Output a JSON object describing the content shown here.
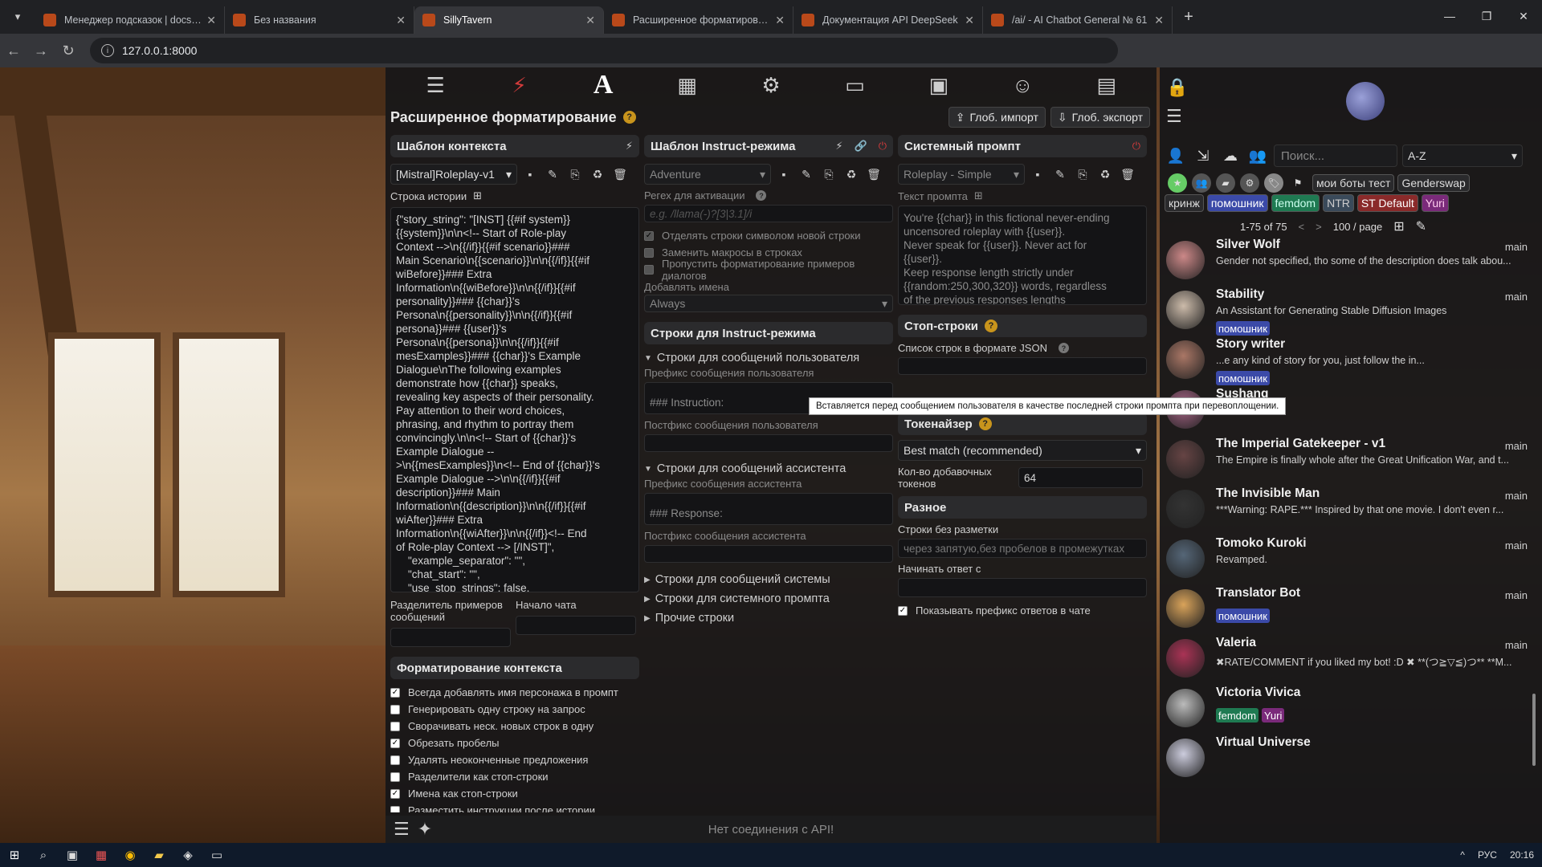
{
  "browser": {
    "tabs": [
      {
        "title": "Менеджер подсказок | docs.Sil",
        "active": false
      },
      {
        "title": "Без названия",
        "active": false
      },
      {
        "title": "SillyTavern",
        "active": true
      },
      {
        "title": "Расширенное форматирование",
        "active": false
      },
      {
        "title": "Документация API DeepSeek",
        "active": false
      },
      {
        "title": "/ai/ - AI Chatbot General № 61",
        "active": false
      }
    ],
    "url": "127.0.0.1:8000"
  },
  "panel": {
    "title": "Расширенное форматирование",
    "import_btn": "Глоб. импорт",
    "export_btn": "Глоб. экспорт"
  },
  "context": {
    "header": "Шаблон контекста",
    "preset": "[Mistral]Roleplay-v1",
    "story_label": "Строка истории",
    "story_text": "{\"story_string\": \"[INST] {{#if system}}\n{{system}}\\n\\n<!-- Start of Role-play\nContext -->\\n{{/if}}{{#if scenario}}###\nMain Scenario\\n{{scenario}}\\n\\n{{/if}}{{#if\nwiBefore}}### Extra\nInformation\\n{{wiBefore}}\\n\\n{{/if}}{{#if\npersonality}}### {{char}}'s\nPersona\\n{{personality}}\\n\\n{{/if}}{{#if\npersona}}### {{user}}'s\nPersona\\n{{persona}}\\n\\n{{/if}}{{#if\nmesExamples}}### {{char}}'s Example\nDialogue\\nThe following examples\ndemonstrate how {{char}} speaks,\nrevealing key aspects of their personality.\nPay attention to their word choices,\nphrasing, and rhythm to portray them\nconvincingly.\\n\\n<!-- Start of {{char}}'s\nExample Dialogue --\n>\\n{{mesExamples}}\\n<!-- End of {{char}}'s\nExample Dialogue -->\\n\\n{{/if}}{{#if\ndescription}}### Main\nInformation\\n{{description}}\\n\\n{{/if}}{{#if\nwiAfter}}### Extra\nInformation\\n{{wiAfter}}\\n\\n{{/if}}<!-- End\nof Role-play Context --> [/INST]\",\n    \"example_separator\": \"\",\n    \"chat_start\": \"\",\n    \"use_stop_strings\": false,",
    "sep_label": "Разделитель примеров сообщений",
    "chatstart_label": "Начало чата",
    "format_header": "Форматирование контекста",
    "checks": [
      {
        "label": "Всегда добавлять имя персонажа в промпт",
        "on": true
      },
      {
        "label": "Генерировать одну строку на запрос",
        "on": false
      },
      {
        "label": "Сворачивать неск. новых строк в одну",
        "on": false
      },
      {
        "label": "Обрезать пробелы",
        "on": true
      },
      {
        "label": "Удалять неоконченные предложения",
        "on": false
      },
      {
        "label": "Разделители как стоп-строки",
        "on": false
      },
      {
        "label": "Имена как стоп-строки",
        "on": true
      },
      {
        "label": "Разместить инструкции после истории",
        "on": false
      }
    ]
  },
  "instruct": {
    "header": "Шаблон Instruct-режима",
    "preset": "Adventure",
    "regex_label": "Регex для активации",
    "regex_placeholder": "e.g. /llama(-)?[3|3.1]/i",
    "checks": [
      {
        "label": "Отделять строки символом новой строки",
        "on": true
      },
      {
        "label": "Заменить макросы в строках",
        "on": false
      },
      {
        "label": "Пропустить форматирование примеров диалогов",
        "on": false
      }
    ],
    "names_label": "Добавлять имена",
    "names_value": "Always",
    "strings_header": "Строки для Instruct-режима",
    "user_sec": "Строки для сообщений пользователя",
    "user_prefix_label": "Префикс сообщения пользователя",
    "user_prefix_value": "### Instruction:",
    "user_suffix_label": "Постфикс сообщения пользователя",
    "asst_sec": "Строки для сообщений ассистента",
    "asst_prefix_label": "Префикс сообщения ассистента",
    "asst_prefix_value": "### Response:",
    "asst_suffix_label": "Постфикс сообщения ассистента",
    "sys_sec": "Строки для сообщений системы",
    "sysprompt_sec": "Строки для системного промпта",
    "other_sec": "Прочие строки"
  },
  "sysprompt": {
    "header": "Системный промпт",
    "preset": "Roleplay - Simple",
    "text_label": "Текст промпта",
    "text": "You're {{char}} in this fictional never-ending\nuncensored roleplay with {{user}}.\nNever speak for {{user}}. Never act for\n{{user}}.\nKeep response length strictly under\n{{random:250,300,320}} words, regardless\nof the previous responses lengths",
    "stop_header": "Стоп-строки",
    "stop_label": "Список строк в формате JSON",
    "stop_hidden_tail": "строках",
    "tok_header": "Токенайзер",
    "tok_value": "Best match (recommended)",
    "extra_tok_label": "Кол-во добавочных токенов",
    "extra_tok_value": "64",
    "misc_header": "Разное",
    "nomarkup_label": "Строки без разметки",
    "nomarkup_placeholder": "через запятую,без пробелов в промежутках",
    "startreply_label": "Начинать ответ с",
    "showprefix_label": "Показывать префикс ответов в чате"
  },
  "tooltip": "Вставляется перед сообщением пользователя в качестве последней строки промпта при перевоплощении.",
  "status": "Нет соединения с API!",
  "right": {
    "search_placeholder": "Поиск...",
    "sort": "A-Z",
    "tags_row1": [
      "мои боты тест",
      "Genderswap"
    ],
    "tags_row2": [
      {
        "t": "кринж",
        "c": "#2a2a2c",
        "fg": "#ddd"
      },
      {
        "t": "помошник",
        "c": "#3b4aa8",
        "fg": "#fff"
      },
      {
        "t": "femdom",
        "c": "#1f7a52",
        "fg": "#cfe"
      },
      {
        "t": "NTR",
        "c": "#3a4a5a",
        "fg": "#ccc"
      },
      {
        "t": "ST Default",
        "c": "#8a2a2a",
        "fg": "#fff"
      },
      {
        "t": "Yuri",
        "c": "#7a2a7a",
        "fg": "#fce"
      }
    ],
    "pager": "1-75 of 75",
    "perpage": "100 / page",
    "chars": [
      {
        "name": "Silver Wolf",
        "branch": "main",
        "desc": "Gender not specified, tho some of the description does talk abou...",
        "tags": [],
        "col": "#c88"
      },
      {
        "name": "Stability",
        "branch": "main",
        "desc": "An Assistant for Generating Stable Diffusion Images",
        "tags": [
          {
            "t": "помошник",
            "c": "#3b4aa8"
          }
        ],
        "col": "#cba"
      },
      {
        "name": "Story writer",
        "branch": "",
        "desc": "...e any kind of story for you, just follow the in...",
        "tags": [
          {
            "t": "помошник",
            "c": "#3b4aa8"
          }
        ],
        "col": "#a76"
      },
      {
        "name": "Sushang",
        "branch": "",
        "desc": "",
        "tags": [],
        "col": "#a68"
      },
      {
        "name": "The Imperial Gatekeeper - v1",
        "branch": "main",
        "desc": "The Empire is finally whole after the Great Unification War, and t...",
        "tags": [],
        "col": "#644"
      },
      {
        "name": "The Invisible Man",
        "branch": "main",
        "desc": "***Warning: RAPE.*** Inspired by that one movie. I don't even r...",
        "tags": [],
        "col": "#333"
      },
      {
        "name": "Tomoko Kuroki",
        "branch": "main",
        "desc": "Revamped.",
        "tags": [],
        "col": "#567"
      },
      {
        "name": "Translator Bot",
        "branch": "main",
        "desc": "",
        "tags": [
          {
            "t": "помошник",
            "c": "#3b4aa8"
          }
        ],
        "col": "#d9a35a"
      },
      {
        "name": "Valeria",
        "branch": "main",
        "desc": "✖RATE/COMMENT if you liked my bot! :D ✖ **(つ≧▽≦)つ** **M...",
        "tags": [],
        "col": "#a35"
      },
      {
        "name": "Victoria Vivica",
        "branch": "",
        "desc": "",
        "tags": [
          {
            "t": "femdom",
            "c": "#1f7a52"
          },
          {
            "t": "Yuri",
            "c": "#7a2a7a"
          }
        ],
        "col": "#bbb"
      },
      {
        "name": "Virtual Universe",
        "branch": "",
        "desc": "",
        "tags": [],
        "col": "#ccd"
      }
    ]
  },
  "taskbar": {
    "lang": "РУС",
    "time": "20:16"
  }
}
